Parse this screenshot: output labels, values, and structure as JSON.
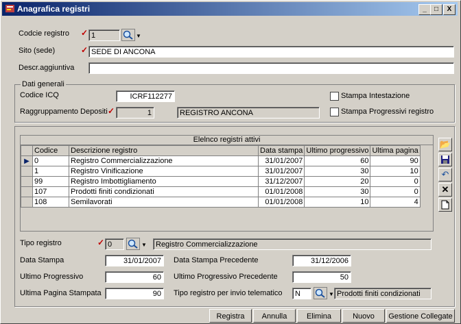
{
  "window": {
    "title": "Anagrafica registri",
    "min_label": "_",
    "max_label": "□",
    "close_label": "X"
  },
  "top": {
    "codice_label": "Codcie registro",
    "codice_value": "1",
    "sito_label": "Sito (sede)",
    "sito_value": "SEDE DI ANCONA",
    "descr_label": "Descr.aggiuntiva",
    "descr_value": ""
  },
  "dati_generali": {
    "group_label": "Dati generali",
    "icq_label": "Codice ICQ",
    "icq_value": "ICRF112277",
    "ragg_label": "Raggruppamento Depositi",
    "ragg_value": "1",
    "ragg_desc": "REGISTRO ANCONA",
    "stampa_intestazione": "Stampa Intestazione",
    "stampa_progressivi": "Stampa Progressivi registro"
  },
  "grid": {
    "caption": "Elelnco registri attivi",
    "columns": [
      "Codice",
      "Descrizione registro",
      "Data stampa",
      "Ultimo progressivo",
      "Ultima pagina"
    ],
    "rows": [
      {
        "codice": "0",
        "descrizione": "Registro Commercializzazione",
        "data": "31/01/2007",
        "progressivo": "60",
        "pagina": "90"
      },
      {
        "codice": "1",
        "descrizione": "Registro Vinificazione",
        "data": "31/01/2007",
        "progressivo": "30",
        "pagina": "10"
      },
      {
        "codice": "99",
        "descrizione": "Registro Imbottigliamento",
        "data": "31/12/2007",
        "progressivo": "20",
        "pagina": "0"
      },
      {
        "codice": "107",
        "descrizione": "Prodotti finiti condizionati",
        "data": "01/01/2008",
        "progressivo": "30",
        "pagina": "0"
      },
      {
        "codice": "108",
        "descrizione": "Semilavorati",
        "data": "01/01/2008",
        "progressivo": "10",
        "pagina": "4"
      }
    ]
  },
  "detail": {
    "tipo_label": "Tipo registro",
    "tipo_value": "0",
    "tipo_desc": "Registro Commercializzazione",
    "data_stampa_label": "Data Stampa",
    "data_stampa_value": "31/01/2007",
    "data_prec_label": "Data Stampa Precedente",
    "data_prec_value": "31/12/2006",
    "ultimo_prog_label": "Ultimo Progressivo",
    "ultimo_prog_value": "60",
    "ultimo_prog_prec_label": "Ultimo Progressivo Precedente",
    "ultimo_prog_prec_value": "50",
    "ultima_pag_label": "Ultima Pagina Stampata",
    "ultima_pag_value": "90",
    "tipo_tel_label": "Tipo registro per invio telematico",
    "tipo_tel_value": "N",
    "tipo_tel_desc": "Prodotti finiti condizionati"
  },
  "buttons": {
    "registra": "Registra",
    "annulla": "Annulla",
    "elimina": "Elimina",
    "nuovo": "Nuovo",
    "collegate": "Gestione Collegate"
  },
  "colors": {
    "title_start": "#0a246a",
    "title_end": "#a6caf0",
    "required_mark": "#c00000"
  }
}
